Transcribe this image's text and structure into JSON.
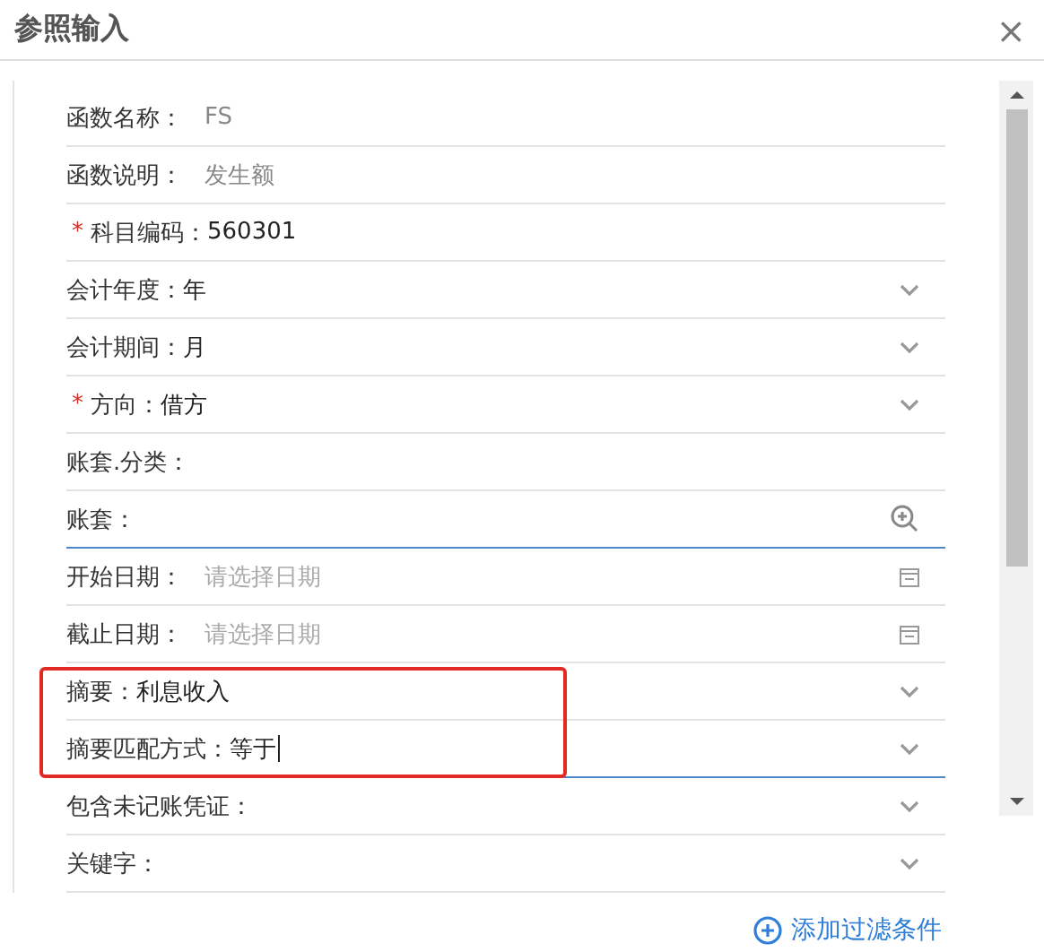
{
  "window": {
    "title": "参照输入",
    "close": "×"
  },
  "fields": [
    {
      "label": "函数名称：",
      "value": "FS",
      "kind": "text",
      "disabled": true
    },
    {
      "label": "函数说明：",
      "value": "发生额",
      "kind": "text",
      "disabled": true
    },
    {
      "label": "科目编码：",
      "value": "560301",
      "kind": "text",
      "required_mark": "*"
    },
    {
      "label": "会计年度：",
      "value": "年",
      "kind": "select"
    },
    {
      "label": "会计期间：",
      "value": "月",
      "kind": "select"
    },
    {
      "label": "方向：",
      "value": "借方",
      "kind": "select",
      "required_mark": "*"
    },
    {
      "label": "账套.分类：",
      "kind": "text"
    },
    {
      "label": "账套：",
      "kind": "lookup",
      "focused": true
    },
    {
      "label": "开始日期：",
      "placeholder": "请选择日期",
      "kind": "date"
    },
    {
      "label": "截止日期：",
      "placeholder": "请选择日期",
      "kind": "date"
    },
    {
      "label": "摘要：",
      "value": "利息收入",
      "kind": "select",
      "highlighted": true
    },
    {
      "label": "摘要匹配方式：",
      "value": "等于",
      "kind": "select",
      "focused": true,
      "caret": true,
      "highlighted": true
    },
    {
      "label": "包含未记账凭证：",
      "kind": "select"
    },
    {
      "label": "关键字：",
      "kind": "select"
    }
  ],
  "add_filter": {
    "label": "添加过滤条件"
  }
}
